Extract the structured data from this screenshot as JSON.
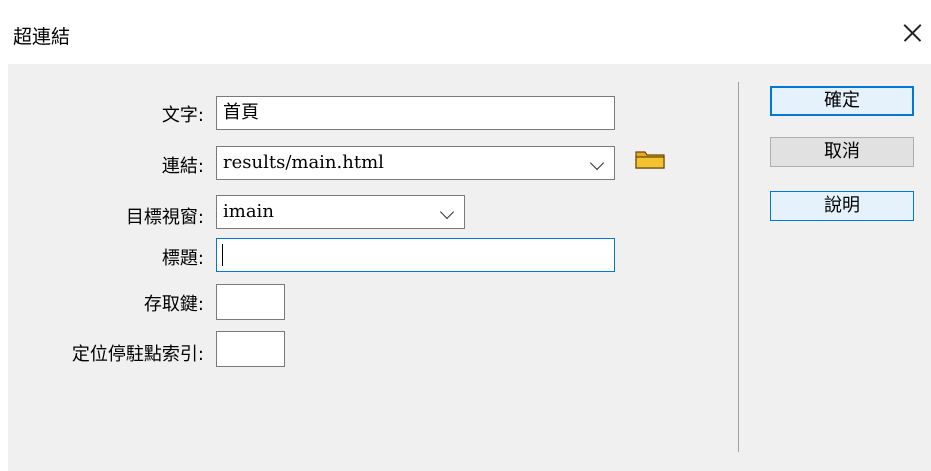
{
  "dialog": {
    "title": "超連結"
  },
  "fields": {
    "text": {
      "label": "文字:",
      "value": "首頁"
    },
    "link": {
      "label": "連結:",
      "value": "results/main.html"
    },
    "target": {
      "label": "目標視窗:",
      "value": "imain"
    },
    "title": {
      "label": "標題:",
      "value": ""
    },
    "access_key": {
      "label": "存取鍵:",
      "value": ""
    },
    "tab_index": {
      "label": "定位停駐點索引:",
      "value": ""
    }
  },
  "buttons": {
    "ok": "確定",
    "cancel": "取消",
    "help": "說明"
  },
  "icons": {
    "close": "close-icon",
    "browse": "folder-icon",
    "dropdown": "chevron-down-icon"
  },
  "colors": {
    "accent": "#0078d7",
    "folder": "#f2c230",
    "dialog_bg": "#f0f0f0"
  }
}
